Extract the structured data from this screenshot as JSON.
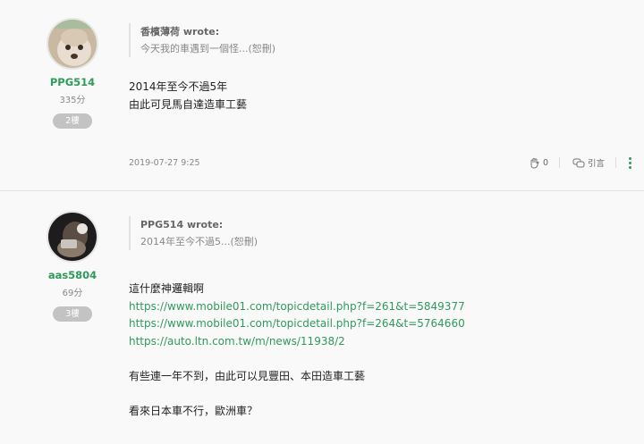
{
  "posts": [
    {
      "author": "PPG514",
      "points": "335分",
      "floor": "2樓",
      "quote_author": "香檳薄荷 wrote:",
      "quote_text": "今天我的車遇到一個怪...(恕刪)",
      "body": [
        "2014年至今不過5年",
        "由此可見馬自達造車工藝"
      ],
      "date": "2019-07-27 9:25",
      "likes": "0",
      "quote_label": "引言"
    },
    {
      "author": "aas5804",
      "points": "69分",
      "floor": "3樓",
      "quote_author": "PPG514 wrote:",
      "quote_text": "2014年至今不過5...(恕刪)",
      "line1": "這什麼神邏輯啊",
      "links": [
        "https://www.mobile01.com/topicdetail.php?f=261&t=5849377",
        "https://www.mobile01.com/topicdetail.php?f=264&t=5764660",
        "https://auto.ltn.com.tw/m/news/11938/2"
      ],
      "line2": "有些連一年不到，由此可以見豐田、本田造車工藝",
      "line3": "看來日本車不行，歐洲車？"
    }
  ],
  "icons": {
    "like": "clap-hand-icon",
    "quote": "quote-chat-icon",
    "more": "vertical-dots-icon"
  },
  "colors": {
    "accent": "#2f9a5a",
    "badge": "#c3c3c3"
  }
}
